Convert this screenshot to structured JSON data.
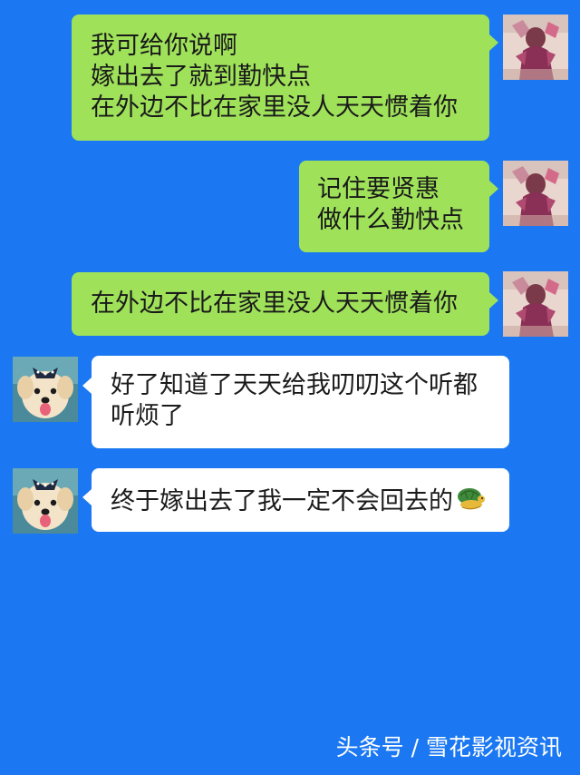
{
  "chat": {
    "messages": [
      {
        "sender": "right",
        "lines": [
          "我可给你说啊",
          "嫁出去了就到勤快点",
          "在外边不比在家里没人天天惯着你"
        ]
      },
      {
        "sender": "right",
        "lines": [
          "记住要贤惠",
          "做什么勤快点"
        ]
      },
      {
        "sender": "right",
        "lines": [
          "在外边不比在家里没人天天惯着你"
        ]
      },
      {
        "sender": "left",
        "lines": [
          "好了知道了天天给我叨叨这个听都",
          "听烦了"
        ]
      },
      {
        "sender": "left",
        "lines": [
          "终于嫁出去了我一定不会回去的"
        ],
        "emoji": "turtle-emoji"
      }
    ]
  },
  "colors": {
    "background": "#1b78f2",
    "sent_bubble": "#9fe25a",
    "received_bubble": "#ffffff"
  },
  "watermark": "头条号 / 雪花影视资讯"
}
